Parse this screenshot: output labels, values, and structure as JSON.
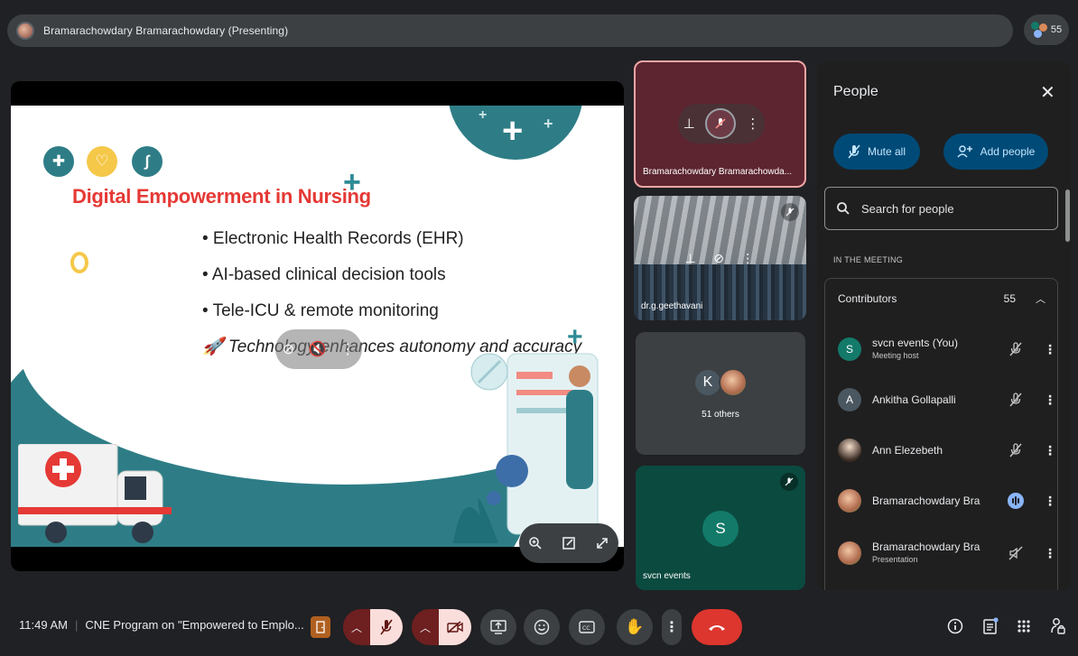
{
  "header": {
    "presenter_title": "Bramarachowdary Bramarachowdary (Presenting)",
    "participant_count": "55"
  },
  "slide": {
    "title": "Digital Empowerment in Nursing",
    "bullets": [
      "• Electronic Health Records (EHR)",
      "• AI-based clinical decision tools",
      "• Tele-ICU & remote monitoring",
      "🚀 Technology enhances autonomy and accuracy"
    ]
  },
  "tiles": {
    "presenter_name": "Bramarachowdary Bramarachowda...",
    "room_name": "dr.g.geethavani",
    "others_initial": "K",
    "others_label": "51 others",
    "self_initial": "S",
    "self_name": "svcn events"
  },
  "people_panel": {
    "title": "People",
    "mute_all": "Mute all",
    "add_people": "Add people",
    "search_placeholder": "Search for people",
    "section_label": "IN THE MEETING",
    "contributors_label": "Contributors",
    "contributors_count": "55",
    "participants": [
      {
        "initial": "S",
        "name": "svcn events (You)",
        "sub": "Meeting host",
        "color": "#137a6a"
      },
      {
        "initial": "A",
        "name": "Ankitha Gollapalli",
        "sub": "",
        "color": "#4a5761"
      },
      {
        "initial": "",
        "name": "Ann Elezebeth",
        "sub": "",
        "color": "#d9c7b8"
      },
      {
        "initial": "",
        "name": "Bramarachowdary Bra...",
        "sub": "",
        "color": "#b06b4e"
      },
      {
        "initial": "",
        "name": "Bramarachowdary Bra...",
        "sub": "Presentation",
        "color": "#b06b4e"
      }
    ]
  },
  "bottom": {
    "time": "11:49 AM",
    "meeting_title": "CNE Program on \"Empowered to Emplo..."
  },
  "colors": {
    "accent_teal": "#2e7d86",
    "title_red": "#e53935",
    "end_call": "#dc362e",
    "muted_bg": "#f9dedc",
    "pill_bg": "#004a77"
  }
}
